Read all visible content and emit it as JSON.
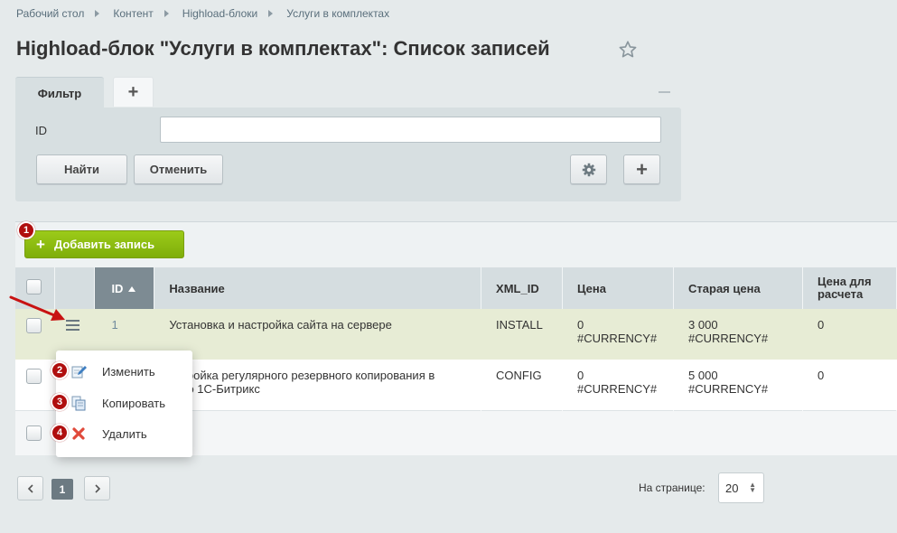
{
  "breadcrumb": [
    "Рабочий стол",
    "Контент",
    "Highload-блоки",
    "Услуги в комплектах"
  ],
  "page_title": "Highload-блок \"Услуги в комплектах\": Список записей",
  "filter": {
    "tab_active": "Фильтр",
    "tab_add": "+",
    "id_label": "ID",
    "id_value": "",
    "find_label": "Найти",
    "cancel_label": "Отменить",
    "plus_label": "+"
  },
  "toolbar": {
    "add_record_label": "Добавить запись",
    "add_record_plus": "+"
  },
  "badges": [
    "1",
    "2",
    "3",
    "4"
  ],
  "table": {
    "columns": [
      "ID",
      "Название",
      "XML_ID",
      "Цена",
      "Старая цена",
      "Цена для расчета"
    ],
    "rows": [
      {
        "id": "1",
        "name": "Установка и настройка сайта на сервере",
        "xml_id": "INSTALL",
        "price_1": "0",
        "price_2": "#CURRENCY#",
        "old_price_1": "3 000",
        "old_price_2": "#CURRENCY#",
        "calc": "0"
      },
      {
        "id": "",
        "name_1": "стройка регулярного резервного копирования в",
        "name_2": "ако 1С-Битрикс",
        "xml_id": "CONFIG",
        "price_1": "0",
        "price_2": "#CURRENCY#",
        "old_price_1": "5 000",
        "old_price_2": "#CURRENCY#",
        "calc": "0"
      }
    ]
  },
  "context_menu": [
    {
      "label": "Изменить",
      "icon": "edit-icon"
    },
    {
      "label": "Копировать",
      "icon": "copy-icon"
    },
    {
      "label": "Удалить",
      "icon": "delete-icon"
    }
  ],
  "pagination": {
    "current": "1",
    "per_page_label": "На странице:",
    "per_page_value": "20"
  },
  "colors": {
    "accent_green": "#8ebd12",
    "badge_red": "#b00e0e",
    "header_sorted": "#7d8b93",
    "row_selected": "#e7ecd5"
  }
}
